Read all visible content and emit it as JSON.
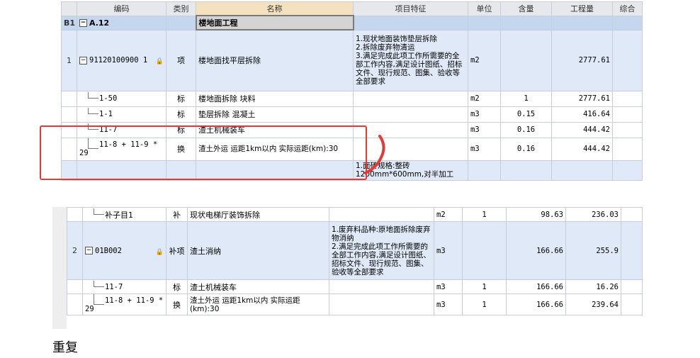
{
  "top_grid": {
    "headers": [
      "编码",
      "类别",
      "名称",
      "项目特征",
      "单位",
      "含量",
      "工程量",
      "综合"
    ],
    "b1": {
      "num": "B1",
      "code": "A.12",
      "name": "楼地面工程"
    },
    "item1": {
      "num": "1",
      "code": "91120100900 1",
      "type": "项",
      "name": "楼地面找平层拆除",
      "feature": "1.现状地面装饰垫层拆除\n2.拆除废弃物清运\n3.满足完成此项工作所需要的全部工作内容,满足设计图纸、招标文件、现行规范、图集、验收等全部要求",
      "unit": "m2",
      "qty": "2777.61"
    },
    "sub_rows": [
      {
        "code": "1-50",
        "type": "标",
        "name": "楼地面拆除 块料",
        "unit": "m2",
        "content": "1",
        "qty": "2777.61"
      },
      {
        "code": "1-1",
        "type": "标",
        "name": "垫层拆除 混凝土",
        "unit": "m3",
        "content": "0.15",
        "qty": "416.64"
      },
      {
        "code": "11-7",
        "type": "标",
        "name": "渣土机械装车",
        "unit": "m3",
        "content": "0.16",
        "qty": "444.42"
      },
      {
        "code": "11-8 + 11-9 * 29",
        "type": "换",
        "name": "渣土外运 运距1km以内  实际运距(km):30",
        "unit": "m3",
        "content": "0.16",
        "qty": "444.42"
      }
    ],
    "cut_row_feature": "1.面砖规格:整砖1200mm*600mm,对半加工"
  },
  "bottom_grid": {
    "sub_top": {
      "code": "补子目1",
      "type": "补",
      "name": "现状电梯厅装饰拆除",
      "unit": "m2",
      "content": "1",
      "qty": "98.63",
      "total": "236.03"
    },
    "item2": {
      "num": "2",
      "code": "01B002",
      "type": "补项",
      "name": "渣土消纳",
      "feature": "1.废弃料品种:原地面拆除废弃物消纳\n2.满足完成此项工作所需要的全部工作内容,满足设计图纸、招标文件、现行规范、图集、验收等全部要求",
      "unit": "m3",
      "qty": "166.66",
      "total": "255.9"
    },
    "sub_rows": [
      {
        "code": "11-7",
        "type": "标",
        "name": "渣土机械装车",
        "unit": "m3",
        "content": "1",
        "qty": "166.66",
        "total": "16.26"
      },
      {
        "code": "11-8 + 11-9 * 29",
        "type": "换",
        "name": "渣土外运 运距1km以内  实际运距(km):30",
        "unit": "m3",
        "content": "1",
        "qty": "166.66",
        "total": "239.64"
      }
    ]
  },
  "caption": "重复",
  "colors": {
    "highlight": "#e53935",
    "row_blue": "#dfe9f7",
    "group_blue": "#c5d7ee"
  }
}
